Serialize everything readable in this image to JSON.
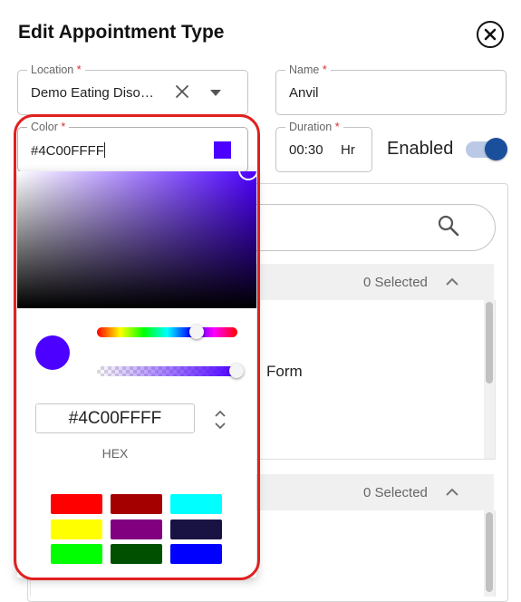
{
  "dialog": {
    "title": "Edit Appointment Type"
  },
  "location": {
    "label": "Location",
    "required_mark": "*",
    "value": "Demo Eating Diso…"
  },
  "name": {
    "label": "Name",
    "required_mark": "*",
    "value": "Anvil"
  },
  "color": {
    "label": "Color",
    "required_mark": "*",
    "value": "#4C00FFFF",
    "swatch": "#4C00FF"
  },
  "duration": {
    "label": "Duration",
    "required_mark": "*",
    "value": "00:30",
    "unit": "Hr"
  },
  "enabled": {
    "label": "Enabled",
    "on": true
  },
  "picker": {
    "hex_value": "#4C00FFFF",
    "mode_label": "HEX",
    "current_color": "#4C00FF",
    "hue": "#4C00FF",
    "alpha": 1.0,
    "presets": [
      "#FF0000",
      "#A50000",
      "#00FFFF",
      "#FFFF00",
      "#800080",
      "#191344",
      "#00FF00",
      "#005000",
      "#0000FF"
    ]
  },
  "background": {
    "section1": {
      "selected_text": "0 Selected"
    },
    "section2": {
      "selected_text": "0 Selected"
    },
    "partial_item": "Form"
  },
  "colors": {
    "highlight": "#E02020",
    "toggle": "#1A4F9C"
  }
}
